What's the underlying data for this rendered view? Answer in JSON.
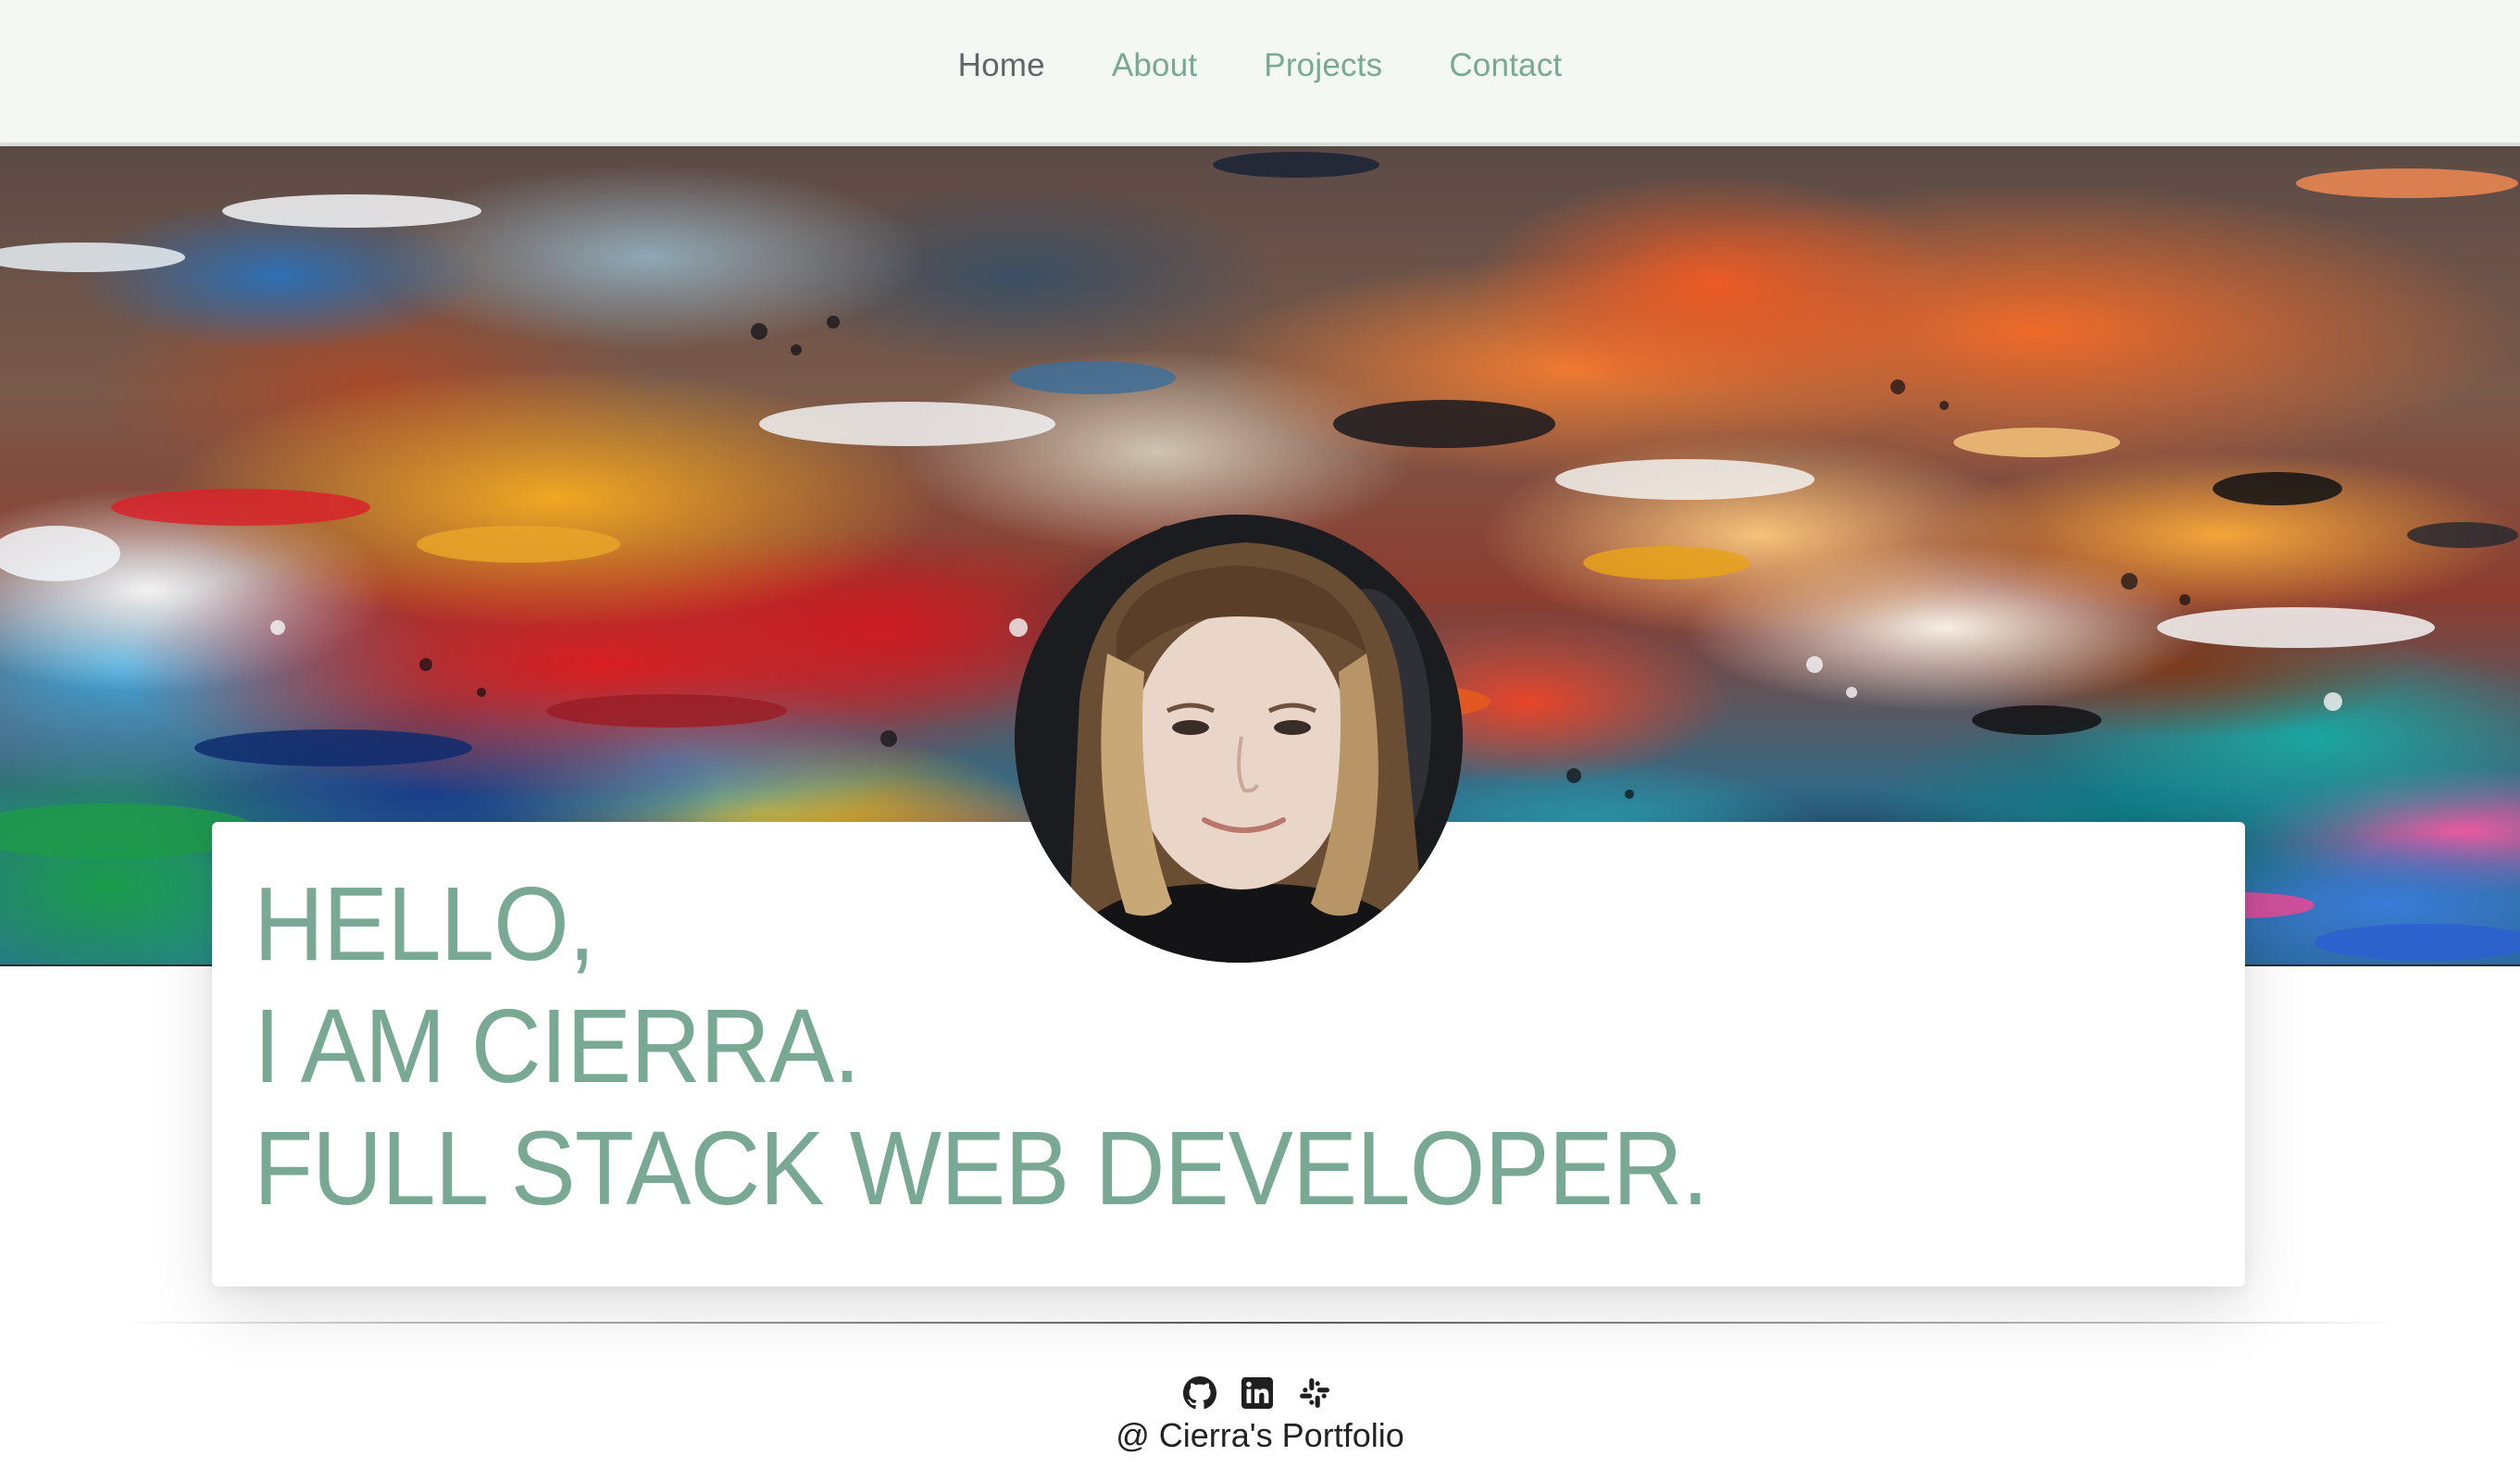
{
  "nav": {
    "items": [
      {
        "label": "Home",
        "active": true
      },
      {
        "label": "About",
        "active": false
      },
      {
        "label": "Projects",
        "active": false
      },
      {
        "label": "Contact",
        "active": false
      }
    ],
    "active_color": "#5e6668",
    "link_color": "#79a995",
    "background": "#f3f8f2"
  },
  "hero": {
    "headline_lines": [
      "HELLO,",
      "I AM CIERRA.",
      "FULL STACK WEB DEVELOPER."
    ],
    "headline_color": "#79a995"
  },
  "footer": {
    "icons": [
      "github-icon",
      "linkedin-icon",
      "slack-icon"
    ],
    "text": "@ Cierra's Portfolio"
  }
}
